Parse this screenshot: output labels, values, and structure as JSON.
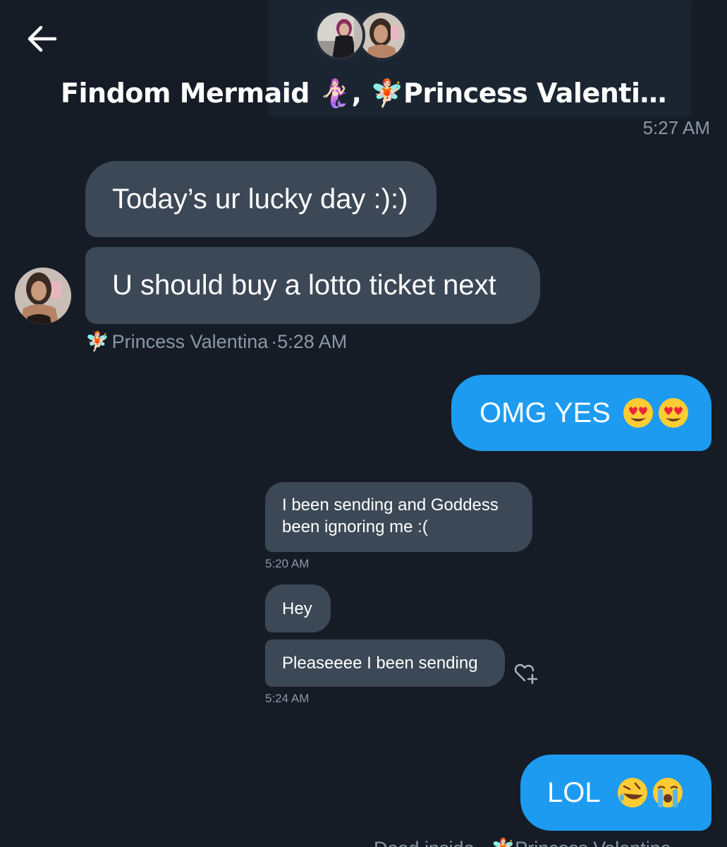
{
  "header": {
    "title": "Findom Mermaid 🧜🏻‍♀️, 🧚🏻Princess Valenti…",
    "back_label": "Back"
  },
  "messages": {
    "top_time": "5:27 AM",
    "incoming_1": "Today’s ur lucky day :):)",
    "incoming_2": "U should buy a lotto ticket next",
    "sender_name": "Princess Valentina",
    "sender_emoji": "🧚🏻",
    "sender_time": "·5:28 AM",
    "outgoing_1": "OMG YES",
    "outgoing_1_emoji": "😍😍",
    "outgoing_2": "LOL",
    "outgoing_2_emoji": "🤣😭",
    "footer_meta": "Dead inside · 🧚🏻Princess Valentina"
  },
  "embedded": {
    "msg_1": "I been sending and Goddess been ignoring me :(",
    "time_1": "5:20 AM",
    "msg_2": "Hey",
    "msg_3": "Pleaseeee I been sending",
    "time_2": "5:24 AM"
  },
  "colors": {
    "background": "#161c26",
    "incoming_bubble": "#3c4856",
    "outgoing_bubble": "#1d9bf0",
    "muted_text": "#8b98a5"
  }
}
